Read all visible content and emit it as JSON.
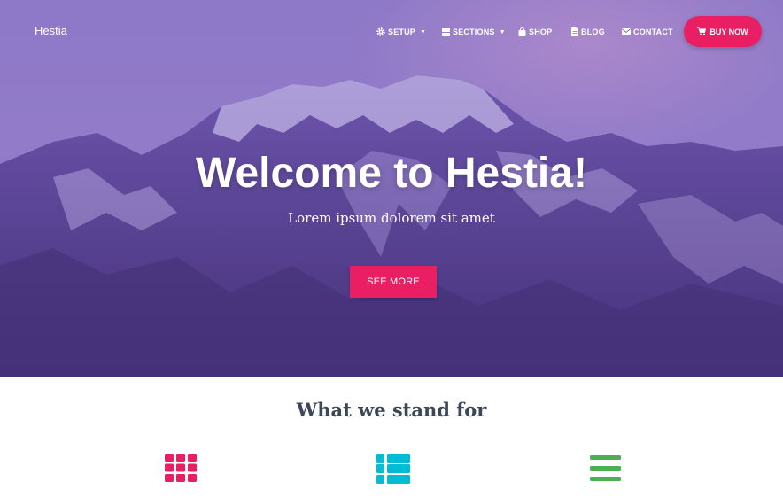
{
  "brand": "Hestia",
  "nav": {
    "items": [
      {
        "label": "SETUP",
        "icon": "gear-icon",
        "dropdown": true
      },
      {
        "label": "SECTIONS",
        "icon": "grid-icon",
        "dropdown": true
      },
      {
        "label": "SHOP",
        "icon": "shopping-bag-icon",
        "dropdown": false
      },
      {
        "label": "BLOG",
        "icon": "document-icon",
        "dropdown": false
      },
      {
        "label": "CONTACT",
        "icon": "envelope-icon",
        "dropdown": false
      }
    ],
    "cta_label": "BUY NOW",
    "cta_icon": "cart-icon"
  },
  "hero": {
    "title": "Welcome to Hestia!",
    "subtitle": "Lorem ipsum dolorem sit amet",
    "button_label": "SEE MORE"
  },
  "features": {
    "title": "What we stand for",
    "icons": [
      {
        "name": "grid-icon",
        "color": "#e91e63"
      },
      {
        "name": "list-icon",
        "color": "#00bcd4"
      },
      {
        "name": "bars-icon",
        "color": "#4caf50"
      }
    ]
  },
  "colors": {
    "accent": "#e91e63",
    "hero_overlay": "#7a5fb8",
    "heading": "#3c4858"
  }
}
